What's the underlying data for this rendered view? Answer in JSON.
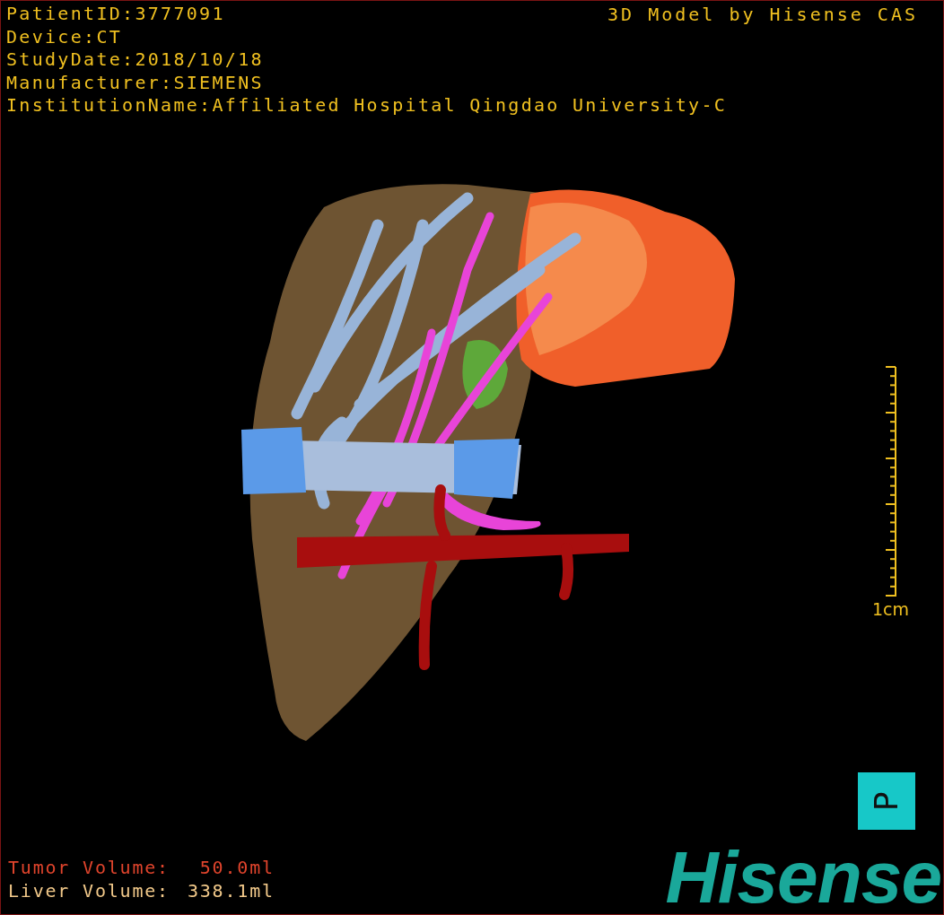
{
  "info": [
    "PatientID:3777091",
    "Device:CT",
    "StudyDate:2018/10/18",
    "Manufacturer:SIEMENS",
    "InstitutionName:Affiliated Hospital Qingdao University-C"
  ],
  "credit": "3D Model by Hisense CAS",
  "scale_bar": {
    "label": "1cm"
  },
  "orientation": {
    "label": "P"
  },
  "volumes": [
    {
      "label": "Tumor Volume:",
      "value": "50.0ml",
      "color": "#e0442c"
    },
    {
      "label": "Liver Volume:",
      "value": "338.1ml",
      "color": "#f2c98a"
    }
  ],
  "logo": "Hisense"
}
